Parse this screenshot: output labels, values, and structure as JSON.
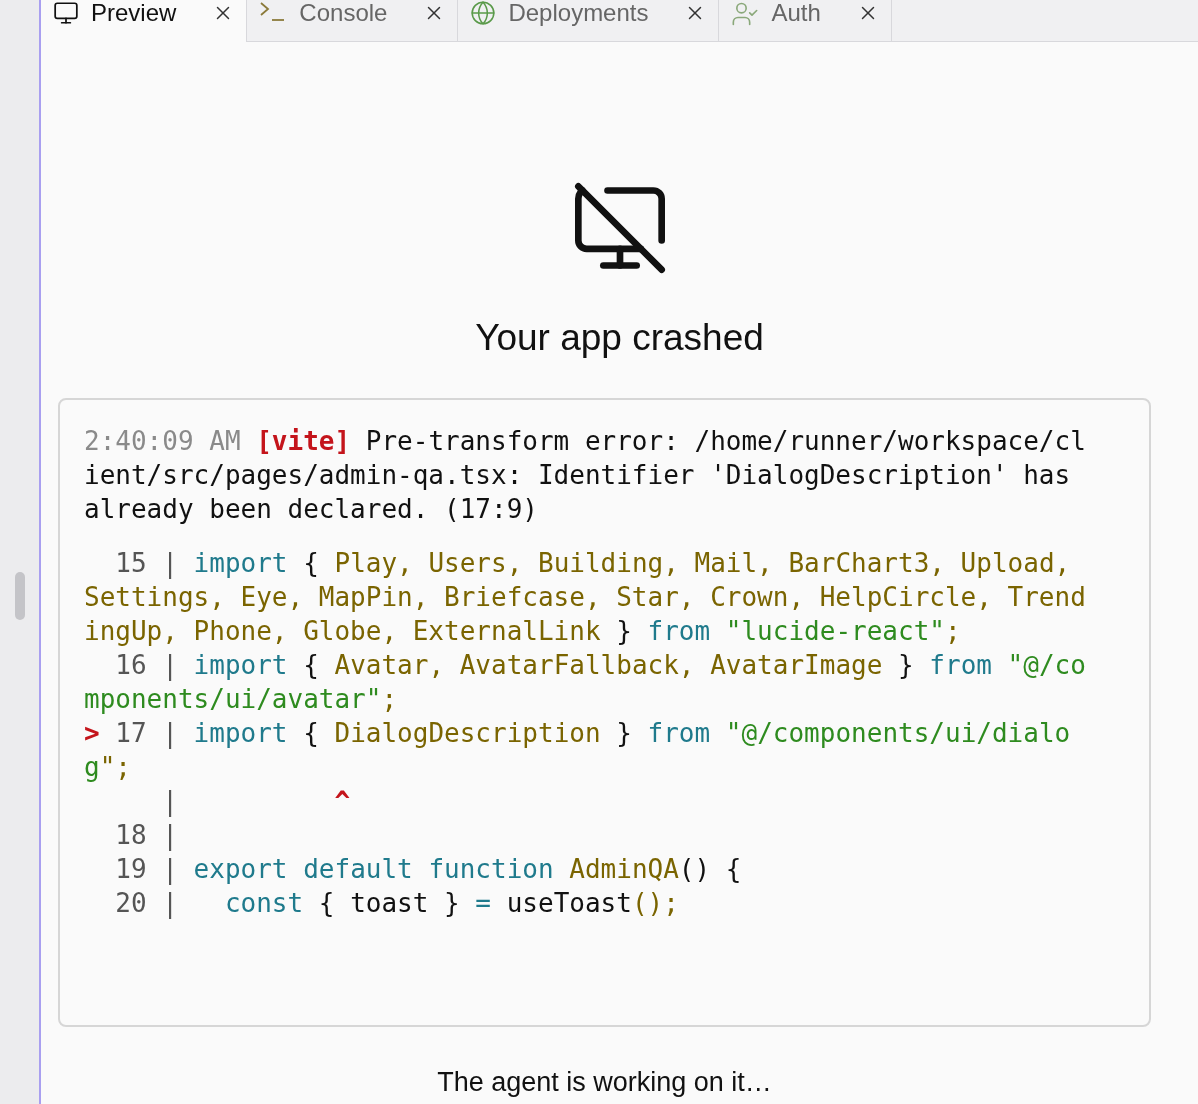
{
  "tabs": [
    {
      "label": "Preview",
      "kind": "monitor",
      "selected": true
    },
    {
      "label": "Console",
      "kind": "terminal",
      "selected": false
    },
    {
      "label": "Deployments",
      "kind": "globe",
      "selected": false
    },
    {
      "label": "Auth",
      "kind": "user",
      "selected": false
    }
  ],
  "title": "Your app crashed",
  "log": [
    {
      "kind": "time",
      "text": "2:40:09 AM "
    },
    {
      "kind": "tag",
      "text": "[vite]"
    },
    {
      "kind": "plain",
      "text": " Pre-transform error: /home/runner/workspace/client/src/pages/admin-qa.tsx: Identifier 'DialogDescription' has already been declared. (17:9)"
    }
  ],
  "code": [
    [
      {
        "kind": "gutter",
        "text": "  15 | "
      },
      {
        "kind": "keyword",
        "text": "import"
      },
      {
        "kind": "plain",
        "text": " { "
      },
      {
        "kind": "ident",
        "text": "Play, Users, Building, Mail, BarChart3, Upload, Settings, Eye, MapPin, Briefcase, Star, Crown, HelpCircle, TrendingUp, Phone, Globe, ExternalLink"
      },
      {
        "kind": "plain",
        "text": " } "
      },
      {
        "kind": "keyword",
        "text": "from "
      },
      {
        "kind": "string",
        "text": "\"lucide-react\""
      },
      {
        "kind": "ident",
        "text": ";"
      }
    ],
    [
      {
        "kind": "gutter",
        "text": "  16 | "
      },
      {
        "kind": "keyword",
        "text": "import"
      },
      {
        "kind": "plain",
        "text": " { "
      },
      {
        "kind": "ident",
        "text": "Avatar, AvatarFallback, AvatarImage"
      },
      {
        "kind": "plain",
        "text": " } "
      },
      {
        "kind": "keyword",
        "text": "from "
      },
      {
        "kind": "string",
        "text": "\"@/components/ui/avatar\""
      },
      {
        "kind": "ident",
        "text": ";"
      }
    ],
    [
      {
        "kind": "marker",
        "text": "> "
      },
      {
        "kind": "gutter",
        "text": "17 | "
      },
      {
        "kind": "keyword",
        "text": "import"
      },
      {
        "kind": "plain",
        "text": " { "
      },
      {
        "kind": "ident",
        "text": "DialogDescription"
      },
      {
        "kind": "plain",
        "text": " } "
      },
      {
        "kind": "keyword",
        "text": "from "
      },
      {
        "kind": "string",
        "text": "\"@/components/ui/dialog"
      },
      {
        "kind": "ident",
        "text": "\";"
      }
    ],
    [
      {
        "kind": "gutter",
        "text": "     |          "
      },
      {
        "kind": "marker",
        "text": "^"
      }
    ],
    [
      {
        "kind": "gutter",
        "text": "  18 |"
      }
    ],
    [
      {
        "kind": "gutter",
        "text": "  19 | "
      },
      {
        "kind": "keyword",
        "text": "export default function "
      },
      {
        "kind": "ident",
        "text": "AdminQA"
      },
      {
        "kind": "plain",
        "text": "() {"
      }
    ],
    [
      {
        "kind": "gutter",
        "text": "  20 | "
      },
      {
        "kind": "keyword",
        "text": "  const"
      },
      {
        "kind": "plain",
        "text": " { toast } "
      },
      {
        "kind": "keyword",
        "text": "="
      },
      {
        "kind": "plain",
        "text": " useToast"
      },
      {
        "kind": "ident",
        "text": "();"
      }
    ]
  ],
  "status": "The agent is working on it…"
}
